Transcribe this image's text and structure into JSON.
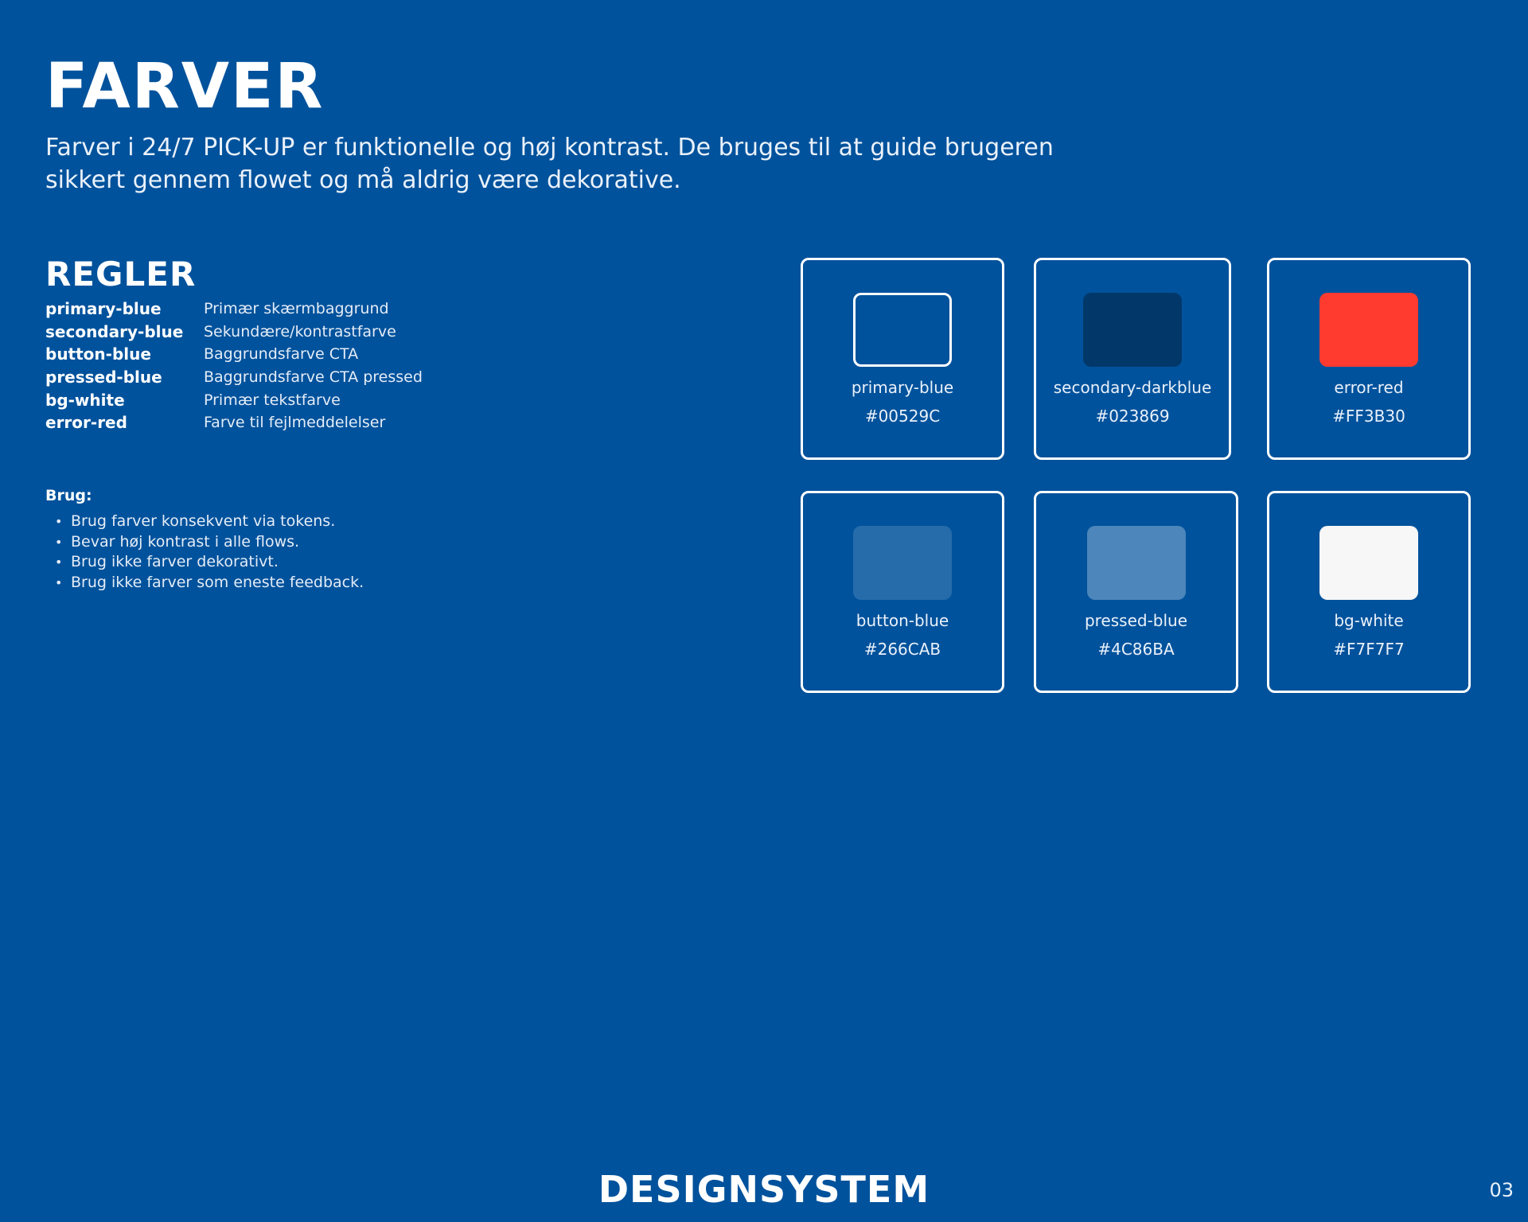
{
  "title": "FARVER",
  "intro": "Farver i 24/7 PICK-UP er funktionelle og høj kontrast. De bruges til at guide brugeren sikkert gennem flowet og må aldrig være dekorative.",
  "rules": {
    "heading": "REGLER",
    "tokens": [
      {
        "name": "primary-blue",
        "desc": "Primær skærmbaggrund"
      },
      {
        "name": "secondary-blue",
        "desc": "Sekundære/kontrastfarve"
      },
      {
        "name": "button-blue",
        "desc": "Baggrundsfarve CTA"
      },
      {
        "name": "pressed-blue",
        "desc": "Baggrundsfarve CTA pressed"
      },
      {
        "name": "bg-white",
        "desc": "Primær tekstfarve"
      },
      {
        "name": "error-red",
        "desc": "Farve til fejlmeddelelser"
      }
    ]
  },
  "usage": {
    "heading": "Brug:",
    "items": [
      "Brug farver konsekvent via tokens.",
      "Bevar høj kontrast i alle flows.",
      "Brug ikke farver dekorativt.",
      "Brug ikke farver som eneste feedback."
    ]
  },
  "swatches": [
    {
      "name": "primary-blue",
      "hex": "#00529C",
      "color": "#00529C"
    },
    {
      "name": "secondary-darkblue",
      "hex": "#023869",
      "color": "#023869"
    },
    {
      "name": "error-red",
      "hex": "#FF3B30",
      "color": "#FF3B30"
    },
    {
      "name": "button-blue",
      "hex": "#266CAB",
      "color": "#266CAB"
    },
    {
      "name": "pressed-blue",
      "hex": "#4C86BA",
      "color": "#4C86BA"
    },
    {
      "name": "bg-white",
      "hex": "#F7F7F7",
      "color": "#F7F7F7"
    }
  ],
  "footer": {
    "title": "DESIGNSYSTEM",
    "page_number": "03"
  },
  "colors": {
    "background": "#00529C",
    "text": "#FFFFFF"
  }
}
